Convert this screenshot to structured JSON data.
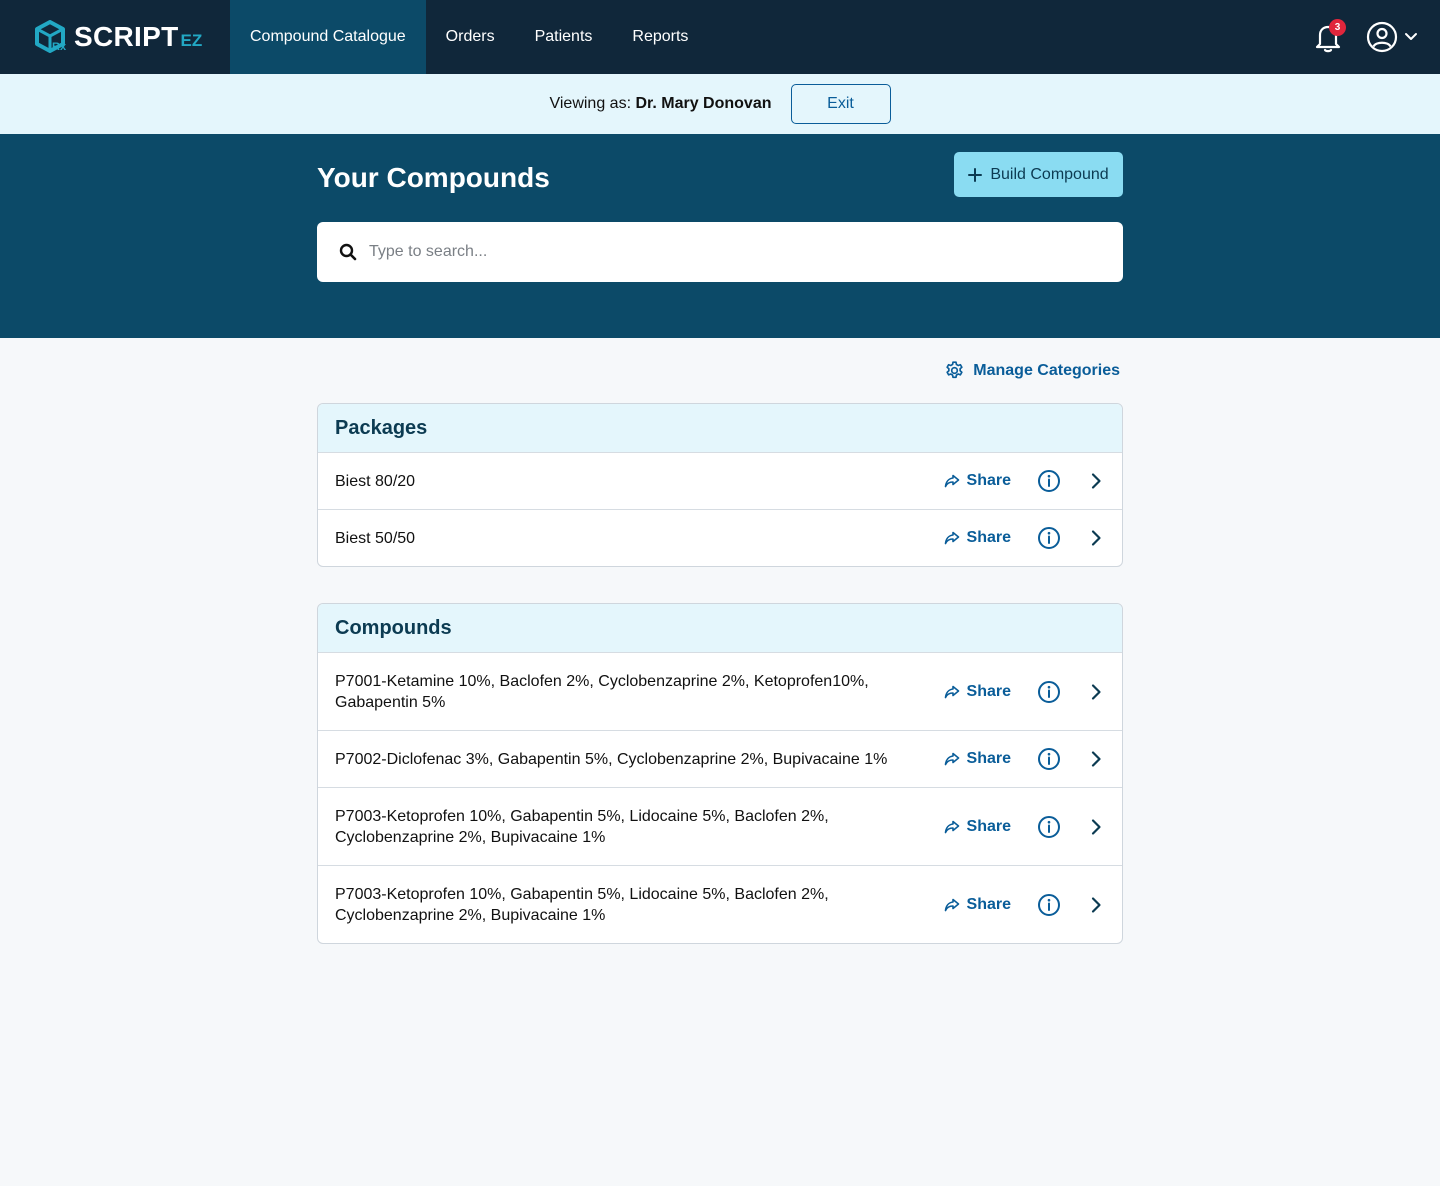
{
  "brand": {
    "name": "SCRIPT",
    "suffix": "EZ"
  },
  "nav": {
    "items": [
      {
        "label": "Compound Catalogue",
        "active": true
      },
      {
        "label": "Orders",
        "active": false
      },
      {
        "label": "Patients",
        "active": false
      },
      {
        "label": "Reports",
        "active": false
      }
    ]
  },
  "notifications": {
    "count": "3"
  },
  "viewing": {
    "prefix": "Viewing as:",
    "name": "Dr. Mary Donovan",
    "exit_label": "Exit"
  },
  "hero": {
    "title": "Your Compounds",
    "build_label": "Build Compound",
    "search_placeholder": "Type to search..."
  },
  "manage_label": "Manage Categories",
  "share_label": "Share",
  "packages": {
    "title": "Packages",
    "items": [
      "Biest 80/20",
      "Biest 50/50"
    ]
  },
  "compounds": {
    "title": "Compounds",
    "items": [
      "P7001-Ketamine 10%, Baclofen 2%, Cyclobenzaprine 2%, Ketoprofen10%, Gabapentin 5%",
      "P7002-Diclofenac 3%, Gabapentin 5%, Cyclobenzaprine 2%, Bupivacaine 1%",
      "P7003-Ketoprofen 10%, Gabapentin 5%, Lidocaine 5%, Baclofen 2%, Cyclobenzaprine 2%, Bupivacaine 1%",
      "P7003-Ketoprofen 10%, Gabapentin 5%, Lidocaine 5%, Baclofen 2%, Cyclobenzaprine 2%, Bupivacaine 1%"
    ]
  },
  "colors": {
    "topbar": "#10273a",
    "hero": "#0c4a68",
    "accent": "#0a5d99",
    "build_button": "#8adcf2",
    "badge": "#e0263c"
  }
}
